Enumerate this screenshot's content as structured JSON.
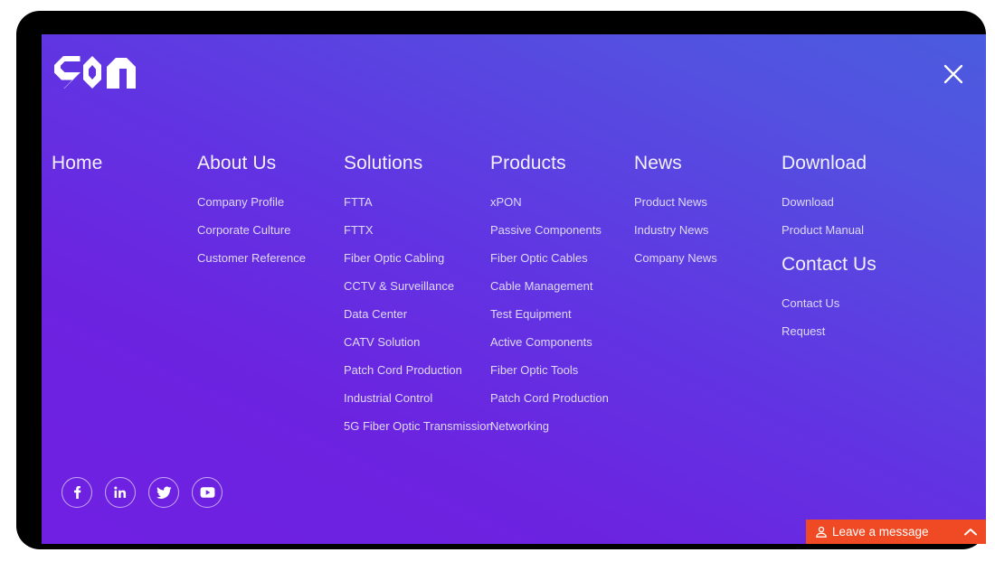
{
  "theme": {
    "gradient_from": "#4a5cdf",
    "gradient_to": "#7020e2",
    "heading_color": "#f2f0fb",
    "link_color": "#ded9f7",
    "chat_accent": "#ef4a23",
    "bezel_color": "#000000"
  },
  "header": {
    "logo_name": "soo-logo",
    "logo_text": "SOO",
    "close_label": "Close menu"
  },
  "columns": [
    {
      "id": "home",
      "title": "Home",
      "links": []
    },
    {
      "id": "about",
      "title": "About Us",
      "links": [
        "Company Profile",
        "Corporate Culture",
        "Customer Reference"
      ]
    },
    {
      "id": "solutions",
      "title": "Solutions",
      "links": [
        "FTTA",
        "FTTX",
        "Fiber Optic Cabling",
        "CCTV & Surveillance",
        "Data Center",
        "CATV Solution",
        "Patch Cord Production",
        "Industrial Control",
        "5G Fiber Optic Transmission"
      ]
    },
    {
      "id": "products",
      "title": "Products",
      "links": [
        "xPON",
        "Passive Components",
        "Fiber Optic Cables",
        "Cable Management",
        "Test Equipment",
        "Active Components",
        "Fiber Optic Tools",
        "Patch Cord Production",
        "Networking"
      ]
    },
    {
      "id": "news",
      "title": "News",
      "links": [
        "Product News",
        "Industry News",
        "Company News"
      ]
    },
    {
      "id": "download",
      "title": "Download",
      "links": [
        "Download",
        "Product Manual"
      ],
      "second_title": "Contact Us",
      "second_links": [
        "Contact Us",
        "Request"
      ]
    }
  ],
  "social": [
    {
      "name": "facebook-icon",
      "label": "Facebook"
    },
    {
      "name": "linkedin-icon",
      "label": "LinkedIn"
    },
    {
      "name": "twitter-icon",
      "label": "Twitter"
    },
    {
      "name": "youtube-icon",
      "label": "YouTube"
    }
  ],
  "chat_widget": {
    "label": "Leave a message",
    "person_icon": "person-icon",
    "chevron_icon": "chevron-up-icon"
  }
}
